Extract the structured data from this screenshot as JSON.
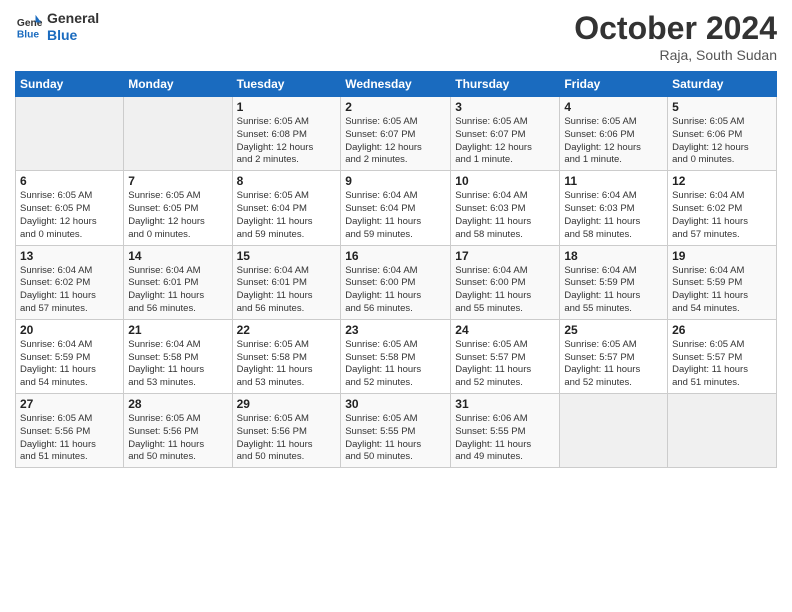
{
  "logo": {
    "text_general": "General",
    "text_blue": "Blue"
  },
  "header": {
    "month": "October 2024",
    "location": "Raja, South Sudan"
  },
  "weekdays": [
    "Sunday",
    "Monday",
    "Tuesday",
    "Wednesday",
    "Thursday",
    "Friday",
    "Saturday"
  ],
  "weeks": [
    [
      {
        "day": "",
        "info": ""
      },
      {
        "day": "",
        "info": ""
      },
      {
        "day": "1",
        "info": "Sunrise: 6:05 AM\nSunset: 6:08 PM\nDaylight: 12 hours\nand 2 minutes."
      },
      {
        "day": "2",
        "info": "Sunrise: 6:05 AM\nSunset: 6:07 PM\nDaylight: 12 hours\nand 2 minutes."
      },
      {
        "day": "3",
        "info": "Sunrise: 6:05 AM\nSunset: 6:07 PM\nDaylight: 12 hours\nand 1 minute."
      },
      {
        "day": "4",
        "info": "Sunrise: 6:05 AM\nSunset: 6:06 PM\nDaylight: 12 hours\nand 1 minute."
      },
      {
        "day": "5",
        "info": "Sunrise: 6:05 AM\nSunset: 6:06 PM\nDaylight: 12 hours\nand 0 minutes."
      }
    ],
    [
      {
        "day": "6",
        "info": "Sunrise: 6:05 AM\nSunset: 6:05 PM\nDaylight: 12 hours\nand 0 minutes."
      },
      {
        "day": "7",
        "info": "Sunrise: 6:05 AM\nSunset: 6:05 PM\nDaylight: 12 hours\nand 0 minutes."
      },
      {
        "day": "8",
        "info": "Sunrise: 6:05 AM\nSunset: 6:04 PM\nDaylight: 11 hours\nand 59 minutes."
      },
      {
        "day": "9",
        "info": "Sunrise: 6:04 AM\nSunset: 6:04 PM\nDaylight: 11 hours\nand 59 minutes."
      },
      {
        "day": "10",
        "info": "Sunrise: 6:04 AM\nSunset: 6:03 PM\nDaylight: 11 hours\nand 58 minutes."
      },
      {
        "day": "11",
        "info": "Sunrise: 6:04 AM\nSunset: 6:03 PM\nDaylight: 11 hours\nand 58 minutes."
      },
      {
        "day": "12",
        "info": "Sunrise: 6:04 AM\nSunset: 6:02 PM\nDaylight: 11 hours\nand 57 minutes."
      }
    ],
    [
      {
        "day": "13",
        "info": "Sunrise: 6:04 AM\nSunset: 6:02 PM\nDaylight: 11 hours\nand 57 minutes."
      },
      {
        "day": "14",
        "info": "Sunrise: 6:04 AM\nSunset: 6:01 PM\nDaylight: 11 hours\nand 56 minutes."
      },
      {
        "day": "15",
        "info": "Sunrise: 6:04 AM\nSunset: 6:01 PM\nDaylight: 11 hours\nand 56 minutes."
      },
      {
        "day": "16",
        "info": "Sunrise: 6:04 AM\nSunset: 6:00 PM\nDaylight: 11 hours\nand 56 minutes."
      },
      {
        "day": "17",
        "info": "Sunrise: 6:04 AM\nSunset: 6:00 PM\nDaylight: 11 hours\nand 55 minutes."
      },
      {
        "day": "18",
        "info": "Sunrise: 6:04 AM\nSunset: 5:59 PM\nDaylight: 11 hours\nand 55 minutes."
      },
      {
        "day": "19",
        "info": "Sunrise: 6:04 AM\nSunset: 5:59 PM\nDaylight: 11 hours\nand 54 minutes."
      }
    ],
    [
      {
        "day": "20",
        "info": "Sunrise: 6:04 AM\nSunset: 5:59 PM\nDaylight: 11 hours\nand 54 minutes."
      },
      {
        "day": "21",
        "info": "Sunrise: 6:04 AM\nSunset: 5:58 PM\nDaylight: 11 hours\nand 53 minutes."
      },
      {
        "day": "22",
        "info": "Sunrise: 6:05 AM\nSunset: 5:58 PM\nDaylight: 11 hours\nand 53 minutes."
      },
      {
        "day": "23",
        "info": "Sunrise: 6:05 AM\nSunset: 5:58 PM\nDaylight: 11 hours\nand 52 minutes."
      },
      {
        "day": "24",
        "info": "Sunrise: 6:05 AM\nSunset: 5:57 PM\nDaylight: 11 hours\nand 52 minutes."
      },
      {
        "day": "25",
        "info": "Sunrise: 6:05 AM\nSunset: 5:57 PM\nDaylight: 11 hours\nand 52 minutes."
      },
      {
        "day": "26",
        "info": "Sunrise: 6:05 AM\nSunset: 5:57 PM\nDaylight: 11 hours\nand 51 minutes."
      }
    ],
    [
      {
        "day": "27",
        "info": "Sunrise: 6:05 AM\nSunset: 5:56 PM\nDaylight: 11 hours\nand 51 minutes."
      },
      {
        "day": "28",
        "info": "Sunrise: 6:05 AM\nSunset: 5:56 PM\nDaylight: 11 hours\nand 50 minutes."
      },
      {
        "day": "29",
        "info": "Sunrise: 6:05 AM\nSunset: 5:56 PM\nDaylight: 11 hours\nand 50 minutes."
      },
      {
        "day": "30",
        "info": "Sunrise: 6:05 AM\nSunset: 5:55 PM\nDaylight: 11 hours\nand 50 minutes."
      },
      {
        "day": "31",
        "info": "Sunrise: 6:06 AM\nSunset: 5:55 PM\nDaylight: 11 hours\nand 49 minutes."
      },
      {
        "day": "",
        "info": ""
      },
      {
        "day": "",
        "info": ""
      }
    ]
  ]
}
